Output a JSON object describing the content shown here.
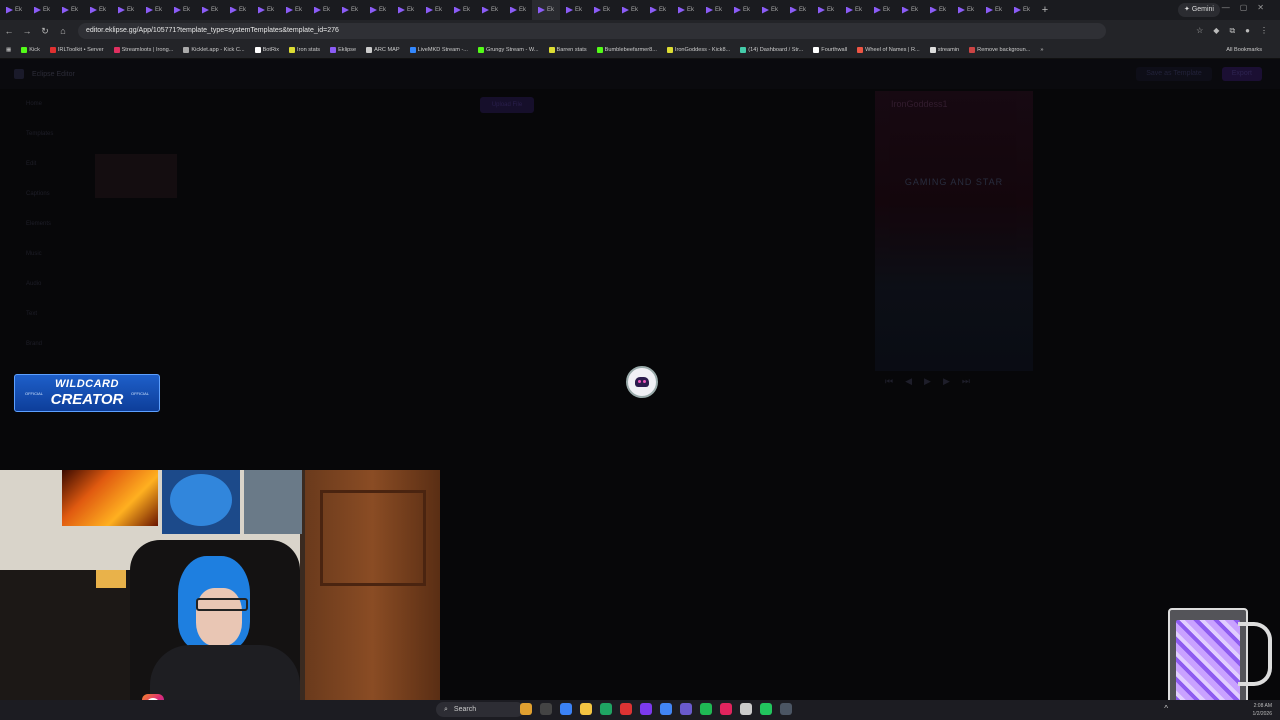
{
  "browser": {
    "tab_label": "Ek",
    "tab_count": 37,
    "new_tab": "+",
    "gemini_label": "Gemini",
    "url": "editor.eklipse.gg/App/105771?template_type=systemTemplates&template_id=276",
    "nav": {
      "back": "←",
      "forward": "→",
      "reload": "↻",
      "home": "⌂"
    },
    "bookmarks": [
      {
        "label": "Kick",
        "color": "#53fc18"
      },
      {
        "label": "IRLToolkit • Server",
        "color": "#e03030"
      },
      {
        "label": "Streamloots | Irong...",
        "color": "#e03060"
      },
      {
        "label": "Kicklet.app - Kick C...",
        "color": "#aaaaaa"
      },
      {
        "label": "BotRix",
        "color": "#ffffff"
      },
      {
        "label": "Iron stats",
        "color": "#dddd33"
      },
      {
        "label": "Eklipse",
        "color": "#8b5cf6"
      },
      {
        "label": "ARC MAP",
        "color": "#cccccc"
      },
      {
        "label": "LiveMKD Stream -...",
        "color": "#3388ff"
      },
      {
        "label": "Grungy Stream - W...",
        "color": "#53fc18"
      },
      {
        "label": "Barren stats",
        "color": "#dddd33"
      },
      {
        "label": "Bumblebeefarmer8...",
        "color": "#53fc18"
      },
      {
        "label": "IronGoddess - Kick8...",
        "color": "#dddd33"
      },
      {
        "label": "(14) Dashboard / Str...",
        "color": "#44ccaa"
      },
      {
        "label": "Fourthwall",
        "color": "#ffffff"
      },
      {
        "label": "Wheel of Names | R...",
        "color": "#ee5544"
      },
      {
        "label": "streamin",
        "color": "#dddddd"
      },
      {
        "label": "Remove backgroun...",
        "color": "#cc4444"
      }
    ],
    "bookmarks_more": "»",
    "all_bookmarks": "All Bookmarks"
  },
  "app": {
    "title": "Eclipse Editor",
    "nav_items": [
      "Home",
      "Templates",
      "Edit",
      "Captions",
      "Elements",
      "Music",
      "Audio",
      "Text",
      "Brand"
    ],
    "upload_label": "Upload File",
    "buttons": [
      "Save as Template",
      "Export"
    ],
    "preview_name": "IronGoddess1",
    "preview_band": "GAMING AND STAR",
    "player_controls": [
      "⏮",
      "◀",
      "▶",
      "▶",
      "⏭"
    ]
  },
  "overlay": {
    "wildcard_line1": "WILDCARD",
    "wildcard_line2": "CREATOR",
    "wildcard_side": "OFFICIAL"
  },
  "taskbar": {
    "search_label": "Search",
    "time": "2:08 AM",
    "date": "1/2/2026",
    "caret": "^"
  }
}
